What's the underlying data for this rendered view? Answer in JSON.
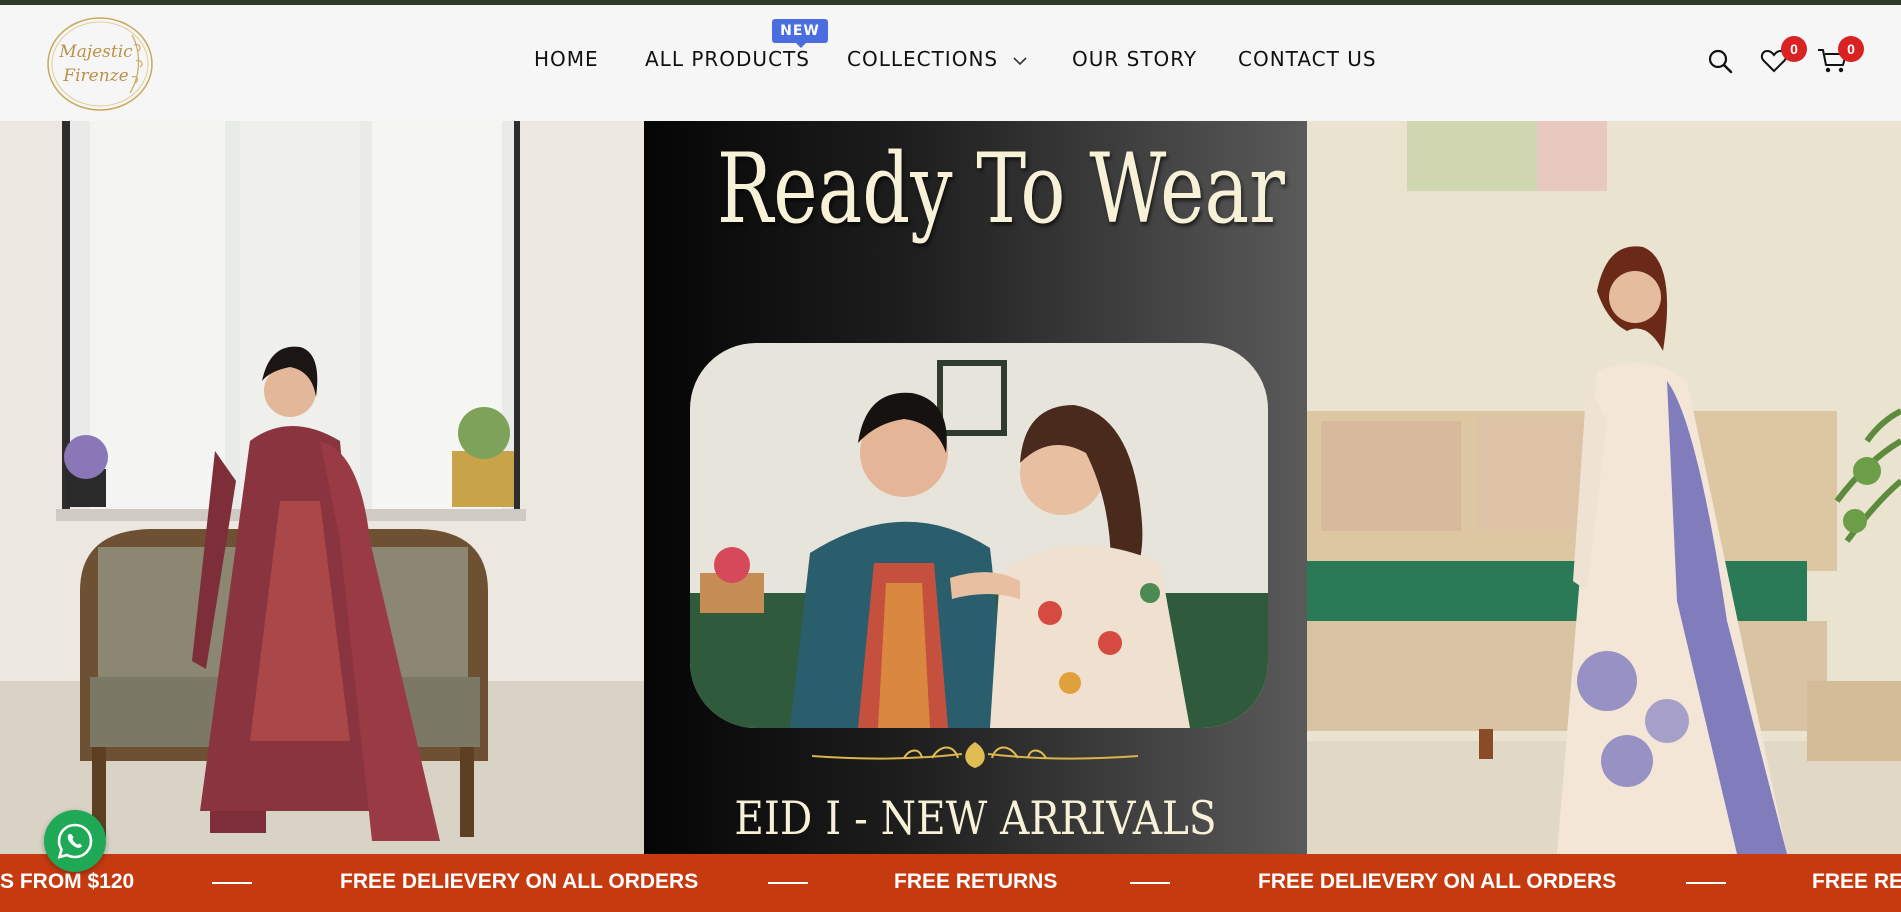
{
  "brand": {
    "name_line1": "Majestic",
    "name_line2": "Firenze",
    "logo_icon": "brand-logo-icon"
  },
  "nav": {
    "items": [
      {
        "label": "HOME"
      },
      {
        "label": "ALL PRODUCTS",
        "badge": "NEW"
      },
      {
        "label": "COLLECTIONS",
        "icon": "chevron-down-icon"
      },
      {
        "label": "OUR STORY"
      },
      {
        "label": "CONTACT US"
      }
    ]
  },
  "header_icons": {
    "search": "search-icon",
    "wishlist": "heart-icon",
    "wishlist_count": "0",
    "cart": "cart-icon",
    "cart_count": "0"
  },
  "hero": {
    "headline": "Ready To Wear",
    "subheadline": "EID I - NEW ARRIVALS"
  },
  "ticker": {
    "items": [
      "S FROM $120",
      "FREE DELIEVERY ON ALL ORDERS",
      "FREE RETURNS",
      "FREE DELIEVERY ON ALL ORDERS",
      "FREE RET"
    ]
  },
  "floating": {
    "whatsapp_icon": "whatsapp-icon"
  },
  "colors": {
    "ticker_bg": "#c63a10",
    "badge_new": "#4a6ee0",
    "count_badge": "#d92222",
    "whatsapp": "#1fa855",
    "headline_cream": "#f7f1d8"
  }
}
